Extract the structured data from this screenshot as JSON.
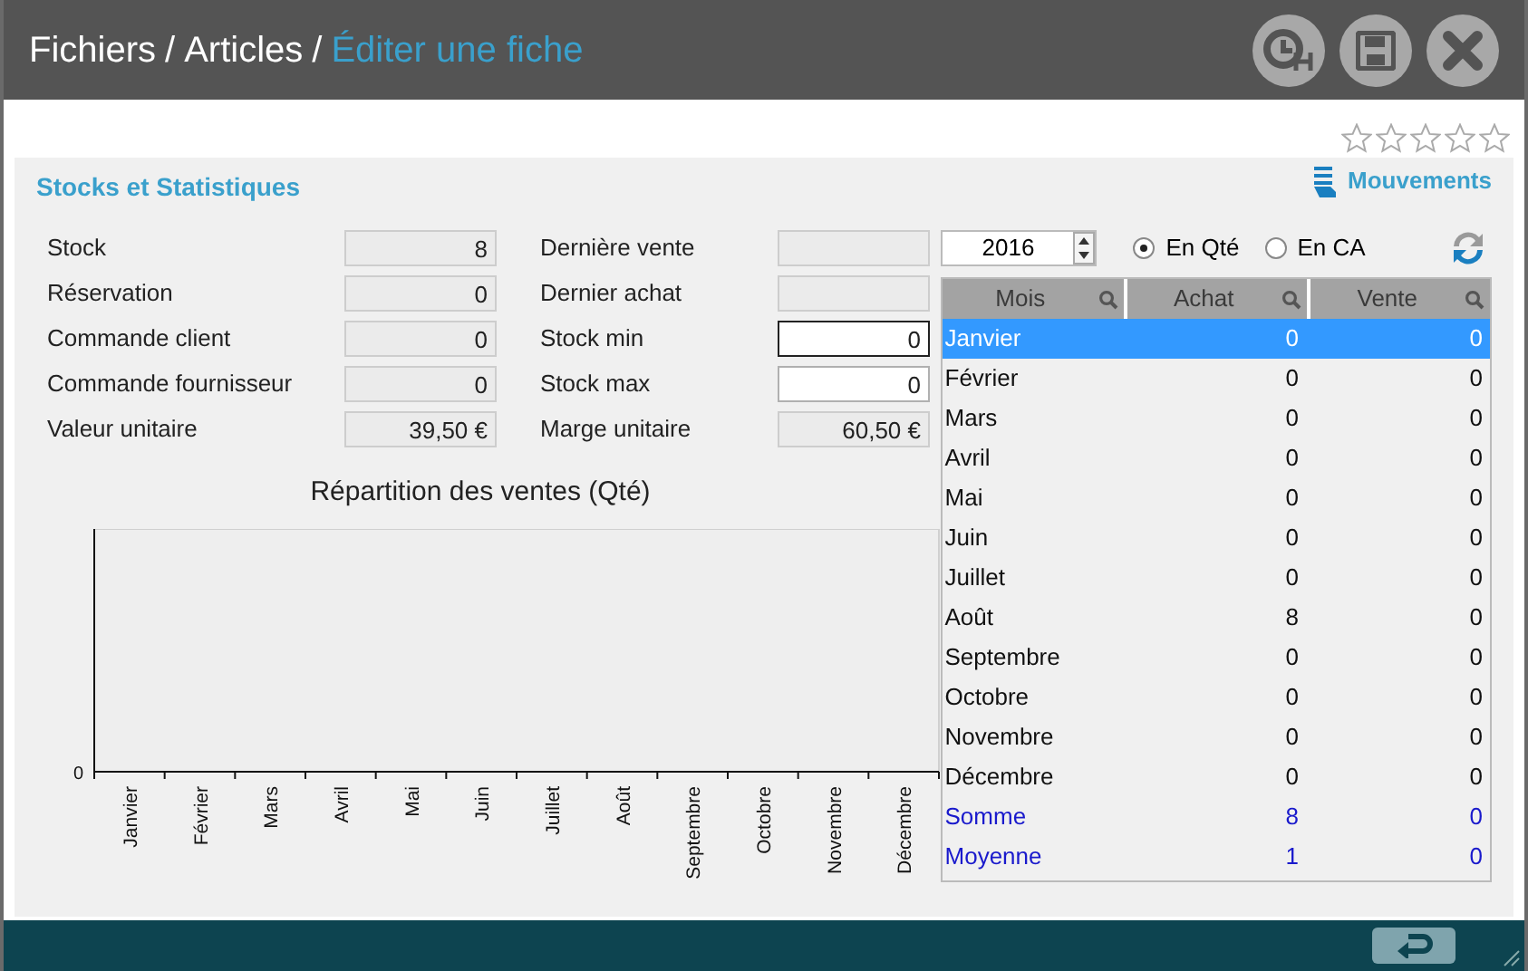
{
  "header": {
    "separator": "/",
    "breadcrumb": [
      {
        "label": "Fichiers",
        "current": false
      },
      {
        "label": "Articles",
        "current": false
      },
      {
        "label": "Éditer une fiche",
        "current": true
      }
    ]
  },
  "rating": {
    "stars": 0
  },
  "section": {
    "title": "Stocks et Statistiques",
    "link": "Mouvements"
  },
  "fields": [
    {
      "label": "Stock",
      "value": "8",
      "editable": false,
      "focused": false
    },
    {
      "label": "Dernière vente",
      "editable": false,
      "focused": false
    },
    {
      "label": "Réservation",
      "value": "0",
      "editable": false,
      "focused": false
    },
    {
      "label": "Dernier achat",
      "editable": false,
      "focused": false
    },
    {
      "label": "Commande client",
      "value": "0",
      "editable": false,
      "focused": false
    },
    {
      "label": "Stock min",
      "value": "0",
      "editable": true,
      "focused": true
    },
    {
      "label": "Commande fournisseur",
      "value": "0",
      "editable": false,
      "focused": false
    },
    {
      "label": "Stock max",
      "value": "0",
      "editable": true,
      "focused": false
    },
    {
      "label": "Valeur unitaire",
      "value": "39,50 €",
      "editable": false,
      "focused": false
    },
    {
      "label": "Marge unitaire",
      "value": "60,50 €",
      "editable": false,
      "focused": false
    }
  ],
  "chart": {
    "title": "Répartition des ventes (Qté)",
    "y_axis_label": "0",
    "x_axis_labels": [
      "Janvier",
      "Février",
      "Mars",
      "Avril",
      "Mai",
      "Juin",
      "Juillet",
      "Août",
      "Septembre",
      "Octobre",
      "Novembre",
      "Décembre"
    ]
  },
  "year": "2016",
  "modes": [
    {
      "label": "En Qté",
      "selected": true
    },
    {
      "label": "En CA",
      "selected": false
    }
  ],
  "table": {
    "columns": [
      "Mois",
      "Achat",
      "Vente"
    ],
    "rows": [
      {
        "cells": [
          "Janvier",
          "0",
          "0"
        ],
        "selected": true,
        "kind": "month"
      },
      {
        "cells": [
          "Février",
          "0",
          "0"
        ],
        "selected": false,
        "kind": "month"
      },
      {
        "cells": [
          "Mars",
          "0",
          "0"
        ],
        "selected": false,
        "kind": "month"
      },
      {
        "cells": [
          "Avril",
          "0",
          "0"
        ],
        "selected": false,
        "kind": "month"
      },
      {
        "cells": [
          "Mai",
          "0",
          "0"
        ],
        "selected": false,
        "kind": "month"
      },
      {
        "cells": [
          "Juin",
          "0",
          "0"
        ],
        "selected": false,
        "kind": "month"
      },
      {
        "cells": [
          "Juillet",
          "0",
          "0"
        ],
        "selected": false,
        "kind": "month"
      },
      {
        "cells": [
          "Août",
          "8",
          "0"
        ],
        "selected": false,
        "kind": "month"
      },
      {
        "cells": [
          "Septembre",
          "0",
          "0"
        ],
        "selected": false,
        "kind": "month"
      },
      {
        "cells": [
          "Octobre",
          "0",
          "0"
        ],
        "selected": false,
        "kind": "month"
      },
      {
        "cells": [
          "Novembre",
          "0",
          "0"
        ],
        "selected": false,
        "kind": "month"
      },
      {
        "cells": [
          "Décembre",
          "0",
          "0"
        ],
        "selected": false,
        "kind": "month"
      },
      {
        "cells": [
          "Somme",
          "8",
          "0"
        ],
        "selected": false,
        "kind": "total"
      },
      {
        "cells": [
          "Moyenne",
          "1",
          "0"
        ],
        "selected": false,
        "kind": "total"
      }
    ]
  }
}
